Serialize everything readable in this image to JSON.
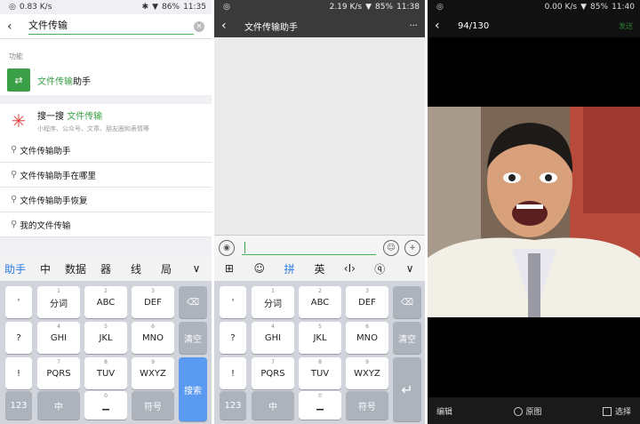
{
  "status": [
    {
      "speed": "0.83 K/s",
      "battery": "86%",
      "time": "11:35"
    },
    {
      "speed": "2.19 K/s",
      "battery": "85%",
      "time": "11:38"
    },
    {
      "speed": "0.00 K/s",
      "battery": "85%",
      "time": "11:40"
    }
  ],
  "search": {
    "query": "文件传输",
    "section_label": "功能",
    "function_item_green": "文件传输",
    "function_item_rest": "助手",
    "sousou_prefix": "搜一搜",
    "sousou_query": "文件传输",
    "sousou_sub": "小程序、公众号、文章、朋友圈和表情等",
    "suggestions": [
      "文件传输助手",
      "文件传输助手在哪里",
      "文件传输助手恢复",
      "我的文件传输"
    ]
  },
  "kb1": {
    "toolbar": [
      "助手",
      "中",
      "数据",
      "器",
      "线",
      "局",
      "∨"
    ],
    "rows": [
      [
        {
          "n": "",
          "l": "'"
        },
        {
          "n": "1",
          "l": "分词"
        },
        {
          "n": "2",
          "l": "ABC"
        },
        {
          "n": "3",
          "l": "DEF"
        }
      ],
      [
        {
          "n": "",
          "l": "。"
        },
        {
          "n": "4",
          "l": "GHI"
        },
        {
          "n": "5",
          "l": "JKL"
        },
        {
          "n": "6",
          "l": "MNO"
        }
      ],
      [
        {
          "n": "",
          "l": "?"
        },
        {
          "n": "7",
          "l": "PQRS"
        },
        {
          "n": "8",
          "l": "TUV"
        },
        {
          "n": "9",
          "l": "WXYZ"
        }
      ]
    ],
    "side": [
      "⌫",
      "清空",
      "搜索"
    ],
    "bottom": {
      "num": "123",
      "cn": "中",
      "space": "0",
      "sym": "符号"
    },
    "extra_punct": "!"
  },
  "chat": {
    "title": "文件传输助手",
    "more": "···"
  },
  "kb2": {
    "toolbar": [
      "⊞",
      "☺",
      "拼",
      "英",
      "‹I›",
      "ⓠ",
      "∨"
    ],
    "side": [
      "⌫",
      "清空",
      "↵"
    ],
    "bottom": {
      "num": "123",
      "cn": "中",
      "space": "0",
      "sym": "符号"
    }
  },
  "viewer": {
    "counter": "94/130",
    "send": "发送",
    "edit": "编辑",
    "original": "原图",
    "select": "选择"
  },
  "colors": {
    "green": "#3a9f46",
    "blue": "#5a9af0",
    "accent": "#2a7ae2"
  }
}
